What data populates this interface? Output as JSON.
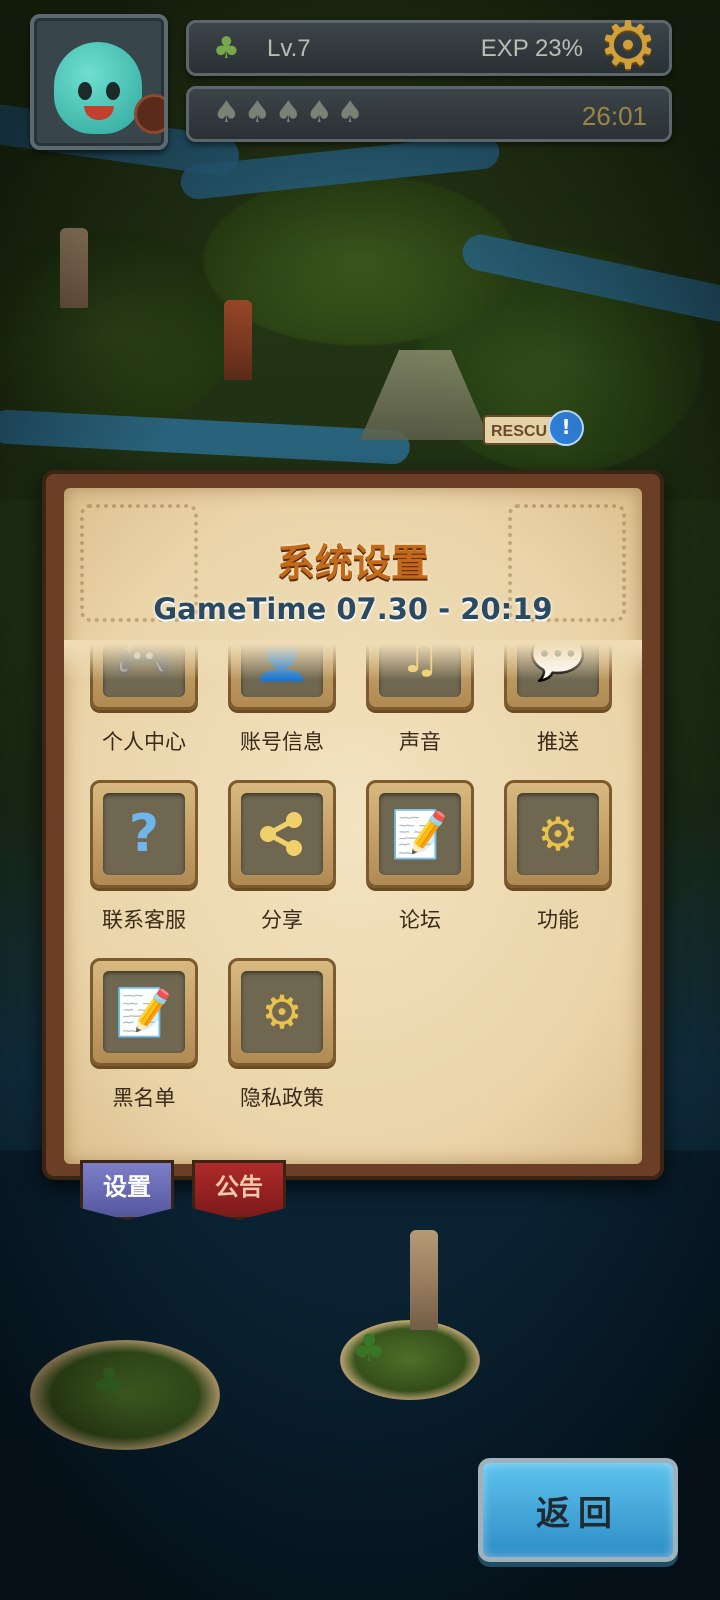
{
  "hud": {
    "level_label": "Lv.7",
    "exp_label": "EXP",
    "exp_percent": "23%",
    "energy_total": 5,
    "timer": "26:01",
    "icons": {
      "level": "tree-icon",
      "settings": "gear-icon",
      "energy": "acorn-icon"
    }
  },
  "map": {
    "rescue_sign": "RESCU",
    "rescue_badge": "!"
  },
  "panel": {
    "title": "系统设置",
    "subtitle": "GameTime 07.30 - 20:19",
    "items": [
      {
        "label": "个人中心",
        "icon": "gamepad-icon"
      },
      {
        "label": "账号信息",
        "icon": "user-icon"
      },
      {
        "label": "声音",
        "icon": "music-note-icon"
      },
      {
        "label": "推送",
        "icon": "chat-bubble-icon"
      },
      {
        "label": "联系客服",
        "icon": "question-icon"
      },
      {
        "label": "分享",
        "icon": "share-icon"
      },
      {
        "label": "论坛",
        "icon": "note-pencil-icon"
      },
      {
        "label": "功能",
        "icon": "gear-icon"
      },
      {
        "label": "黑名单",
        "icon": "note-pencil-icon"
      },
      {
        "label": "隐私政策",
        "icon": "gear-icon"
      }
    ]
  },
  "tabs": {
    "settings": "设置",
    "notice": "公告"
  },
  "back_button": "返回",
  "colors": {
    "title": "#c36a1a",
    "subtitle": "#2a4a62",
    "back_button": "#3aa6dc",
    "tab_settings": "#6a6cb6",
    "tab_notice": "#9a2222"
  }
}
